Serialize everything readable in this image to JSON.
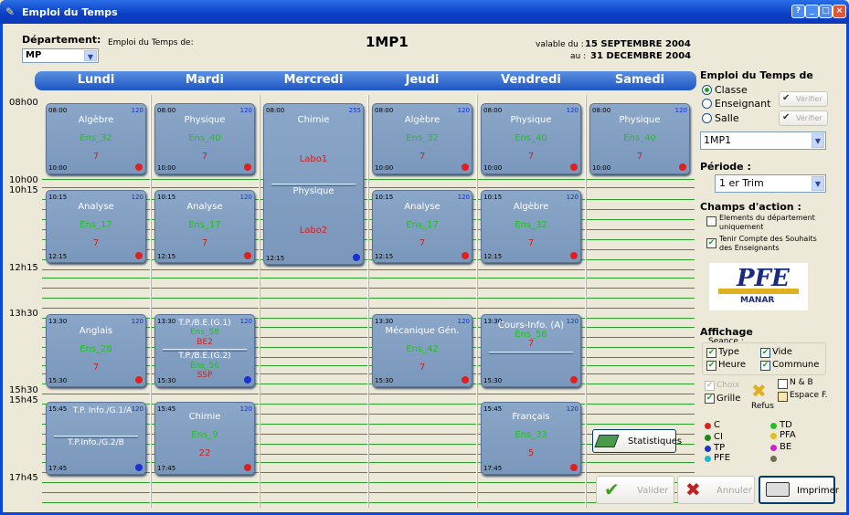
{
  "window": {
    "title": "Emploi du Temps"
  },
  "header": {
    "dept_label": "Département:",
    "dept_value": "MP",
    "emploi_de": "Emploi du Temps de:",
    "class_name": "1MP1",
    "valable_label": "valable du :",
    "valable_from": "15 SEPTEMBRE 2004",
    "au_label": "au :",
    "valable_to": "31 DECEMBRE 2004"
  },
  "days": [
    "Lundi",
    "Mardi",
    "Mercredi",
    "Jeudi",
    "Vendredi",
    "Samedi"
  ],
  "times": [
    "08h00",
    "10h00",
    "10h15",
    "12h15",
    "13h30",
    "15h30",
    "15h45",
    "17h45"
  ],
  "cards": {
    "l1": {
      "start": "08:00",
      "end": "10:00",
      "n": "120",
      "subject": "Algèbre",
      "room": "Ens_32",
      "group": "7"
    },
    "ma1": {
      "start": "08:00",
      "end": "10:00",
      "n": "120",
      "subject": "Physique",
      "room": "Ens_40",
      "group": "7"
    },
    "me1": {
      "start": "08:00",
      "end": "12:15",
      "n": "255",
      "subject": "Chimie",
      "group": "Labo1",
      "subject2": "Physique",
      "group2": "Labo2"
    },
    "j1": {
      "start": "08:00",
      "end": "10:00",
      "n": "120",
      "subject": "Algèbre",
      "room": "Ens_32",
      "group": "7"
    },
    "v1": {
      "start": "08:00",
      "end": "10:00",
      "n": "120",
      "subject": "Physique",
      "room": "Ens_40",
      "group": "7"
    },
    "s1": {
      "start": "08:00",
      "end": "10:00",
      "n": "120",
      "subject": "Physique",
      "room": "Ens_40",
      "group": "7"
    },
    "l2": {
      "start": "10:15",
      "end": "12:15",
      "n": "120",
      "subject": "Analyse",
      "room": "Ens_17",
      "group": "7"
    },
    "ma2": {
      "start": "10:15",
      "end": "12:15",
      "n": "120",
      "subject": "Analyse",
      "room": "Ens_17",
      "group": "7"
    },
    "j2": {
      "start": "10:15",
      "end": "12:15",
      "n": "120",
      "subject": "Analyse",
      "room": "Ens_17",
      "group": "7"
    },
    "v2": {
      "start": "10:15",
      "end": "12:15",
      "n": "120",
      "subject": "Algèbre",
      "room": "Ens_32",
      "group": "7"
    },
    "l3": {
      "start": "13:30",
      "end": "15:30",
      "n": "120",
      "subject": "Anglais",
      "room": "Ens_28",
      "group": "7"
    },
    "ma3": {
      "start": "13:30",
      "end": "15:30",
      "n": "120",
      "subject": "T.P./B.E.(G.1)",
      "room": "Ens_58",
      "group": "BE2",
      "subject2": "T.P./B.E.(G.2)",
      "room2": "Ens_56",
      "group2": "SSP"
    },
    "j3": {
      "start": "13:30",
      "end": "15:30",
      "n": "120",
      "subject": "Mécanique Gén.",
      "room": "Ens_42",
      "group": "7"
    },
    "v3": {
      "start": "13:30",
      "end": "15:30",
      "n": "120",
      "subject": "Cours-Info. (A)",
      "room": "Ens_56",
      "group": "7"
    },
    "l4": {
      "start": "15:45",
      "end": "17:45",
      "n": "120",
      "subject": "T.P. Info./G.1/A",
      "subject2": "T.P.Info./G.2/B"
    },
    "ma4": {
      "start": "15:45",
      "end": "17:45",
      "n": "120",
      "subject": "Chimie",
      "room": "Ens_9",
      "group": "22"
    },
    "v4": {
      "start": "15:45",
      "end": "17:45",
      "n": "120",
      "subject": "Français",
      "room": "Ens_33",
      "group": "5"
    }
  },
  "panel": {
    "emploi_title": "Emploi du Temps de",
    "opt_classe": "Classe",
    "opt_enseignant": "Enseignant",
    "opt_salle": "Salle",
    "verifier1": "Vérifier",
    "verifier2": "Vérifier",
    "select_value": "1MP1",
    "periode_title": "Période :",
    "periode_value": "1 er Trim",
    "champs_title": "Champs d'action :",
    "chk1": "Elements du département uniquement",
    "chk2": "Tenir Compte des Souhaits des Enseignants",
    "logo_text": "PFE",
    "logo_sub": "MANAR",
    "affichage_title": "Affichage",
    "seance_label": "Seance :",
    "type": "Type",
    "vide": "Vide",
    "heure": "Heure",
    "commune": "Commune",
    "choix": "Choix",
    "nb": "N & B",
    "grille": "Grille",
    "espace": "Espace F.",
    "refus": "Refus",
    "legend": [
      {
        "code": "C",
        "color": "#e02020"
      },
      {
        "code": "TD",
        "color": "#20c020"
      },
      {
        "code": "CI",
        "color": "#1a8a1a"
      },
      {
        "code": "PFA",
        "color": "#e0c010"
      },
      {
        "code": "TP",
        "color": "#1a30d0"
      },
      {
        "code": "BE",
        "color": "#d020d0"
      },
      {
        "code": "PFE",
        "color": "#20b8c8"
      },
      {
        "code": "",
        "color": "#707050"
      }
    ],
    "statistiques": "Statistiques",
    "valider": "Valider",
    "annuler": "Annuler",
    "imprimer": "Imprimer"
  }
}
